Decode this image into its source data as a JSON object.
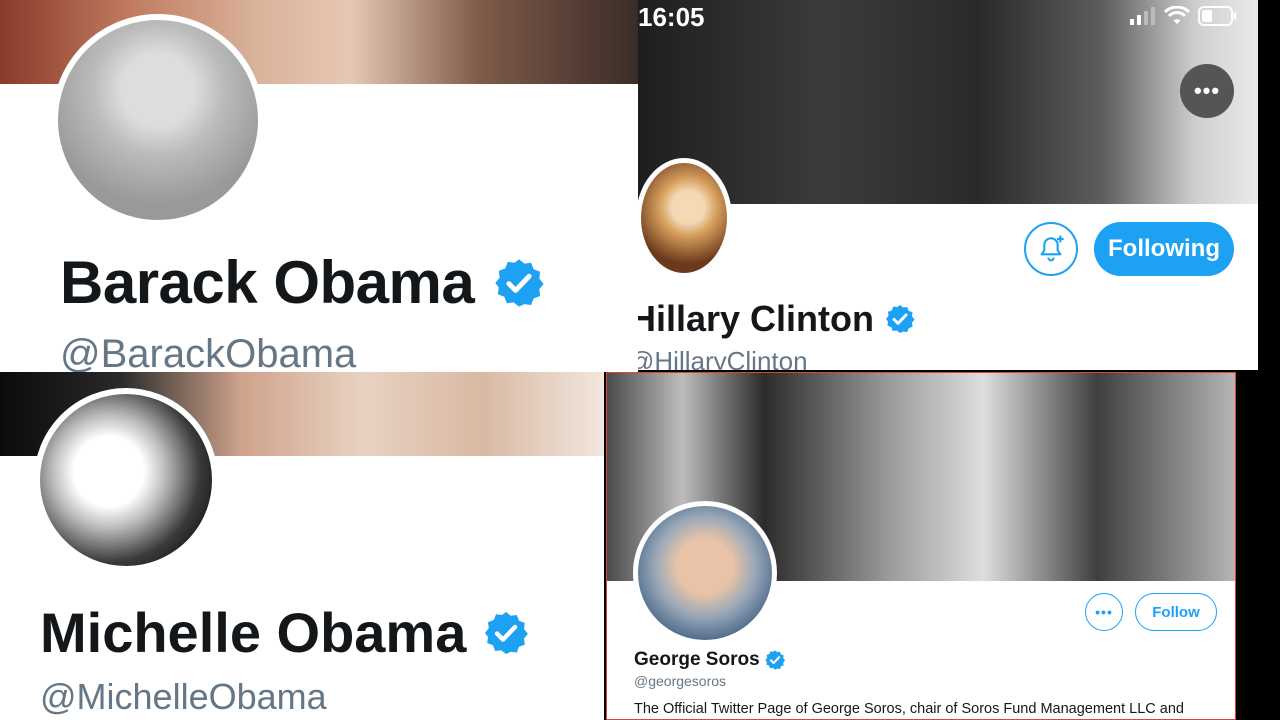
{
  "obama": {
    "name": "Barack Obama",
    "handle": "@BarackObama"
  },
  "hillary": {
    "status_time": "16:05",
    "more_label": "•••",
    "following_label": "Following",
    "name": "Hillary Clinton",
    "handle": "@HillaryClinton"
  },
  "michelle": {
    "name": "Michelle Obama",
    "handle": "@MichelleObama"
  },
  "soros": {
    "more_label": "•••",
    "follow_label": "Follow",
    "name": "George Soros",
    "handle": "@georgesoros",
    "bio": "The Official Twitter Page of George Soros, chair of Soros Fund Management LLC and"
  },
  "icons": {
    "verified": "verified-badge-icon",
    "bell": "bell-plus-icon",
    "signal": "signal-icon",
    "wifi": "wifi-icon",
    "battery": "battery-icon"
  },
  "colors": {
    "accent": "#1da1f2",
    "text": "#14171a",
    "muted": "#657786"
  }
}
